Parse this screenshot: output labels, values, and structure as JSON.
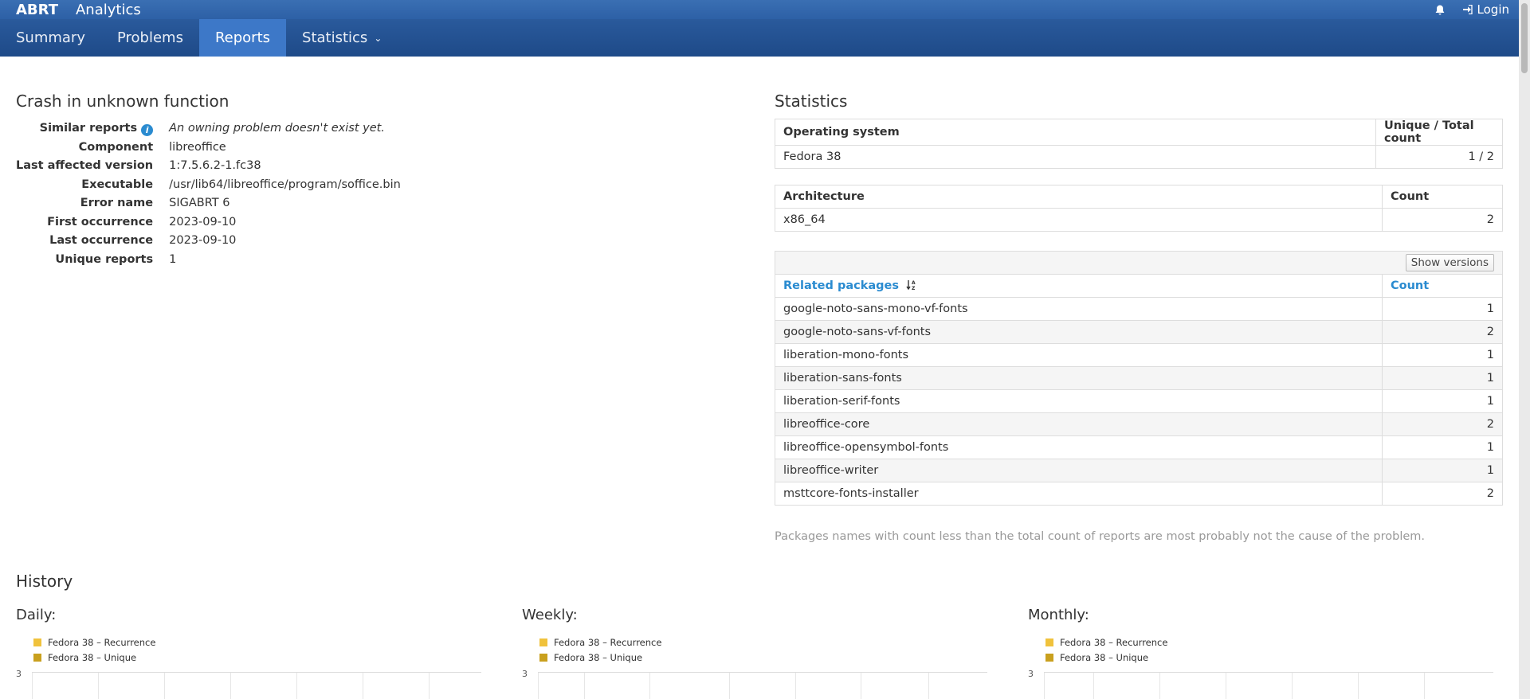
{
  "header": {
    "brand": "ABRT",
    "section": "Analytics",
    "login_label": "Login",
    "bell_icon": "bell-icon",
    "login_icon": "sign-in-icon"
  },
  "nav": {
    "items": [
      {
        "label": "Summary",
        "active": false
      },
      {
        "label": "Problems",
        "active": false
      },
      {
        "label": "Reports",
        "active": true
      },
      {
        "label": "Statistics",
        "active": false,
        "dropdown": true
      }
    ]
  },
  "report": {
    "title": "Crash in unknown function",
    "fields": [
      {
        "label": "Similar reports",
        "value": "An owning problem doesn't exist yet."
      },
      {
        "label": "Component",
        "value": "libreoffice"
      },
      {
        "label": "Last affected version",
        "value": "1:7.5.6.2-1.fc38"
      },
      {
        "label": "Executable",
        "value": "/usr/lib64/libreoffice/program/soffice.bin"
      },
      {
        "label": "Error name",
        "value": "SIGABRT 6"
      },
      {
        "label": "First occurrence",
        "value": "2023-09-10"
      },
      {
        "label": "Last occurrence",
        "value": "2023-09-10"
      },
      {
        "label": "Unique reports",
        "value": "1"
      }
    ]
  },
  "statistics": {
    "title": "Statistics",
    "os_table": {
      "headers": [
        "Operating system",
        "Unique / Total count"
      ],
      "rows": [
        [
          "Fedora 38",
          "1 / 2"
        ]
      ]
    },
    "arch_table": {
      "headers": [
        "Architecture",
        "Count"
      ],
      "rows": [
        [
          "x86_64",
          "2"
        ]
      ]
    },
    "packages_table": {
      "show_versions_label": "Show versions",
      "headers": [
        "Related packages",
        "Count"
      ],
      "rows": [
        [
          "google-noto-sans-mono-vf-fonts",
          "1"
        ],
        [
          "google-noto-sans-vf-fonts",
          "2"
        ],
        [
          "liberation-mono-fonts",
          "1"
        ],
        [
          "liberation-sans-fonts",
          "1"
        ],
        [
          "liberation-serif-fonts",
          "1"
        ],
        [
          "libreoffice-core",
          "2"
        ],
        [
          "libreoffice-opensymbol-fonts",
          "1"
        ],
        [
          "libreoffice-writer",
          "1"
        ],
        [
          "msttcore-fonts-installer",
          "2"
        ]
      ]
    },
    "note": "Packages names with count less than the total count of reports are most probably not the cause of the problem."
  },
  "history": {
    "title": "History",
    "charts": [
      {
        "title": "Daily:",
        "legend": [
          "Fedora 38 – Recurrence",
          "Fedora 38 – Unique"
        ],
        "y_top": "3"
      },
      {
        "title": "Weekly:",
        "legend": [
          "Fedora 38 – Recurrence",
          "Fedora 38 – Unique"
        ],
        "y_top": "3"
      },
      {
        "title": "Monthly:",
        "legend": [
          "Fedora 38 – Recurrence",
          "Fedora 38 – Unique"
        ],
        "y_top": "3"
      }
    ],
    "colors": {
      "recurrence": "#f0c23c",
      "unique": "#c9a01e"
    }
  }
}
